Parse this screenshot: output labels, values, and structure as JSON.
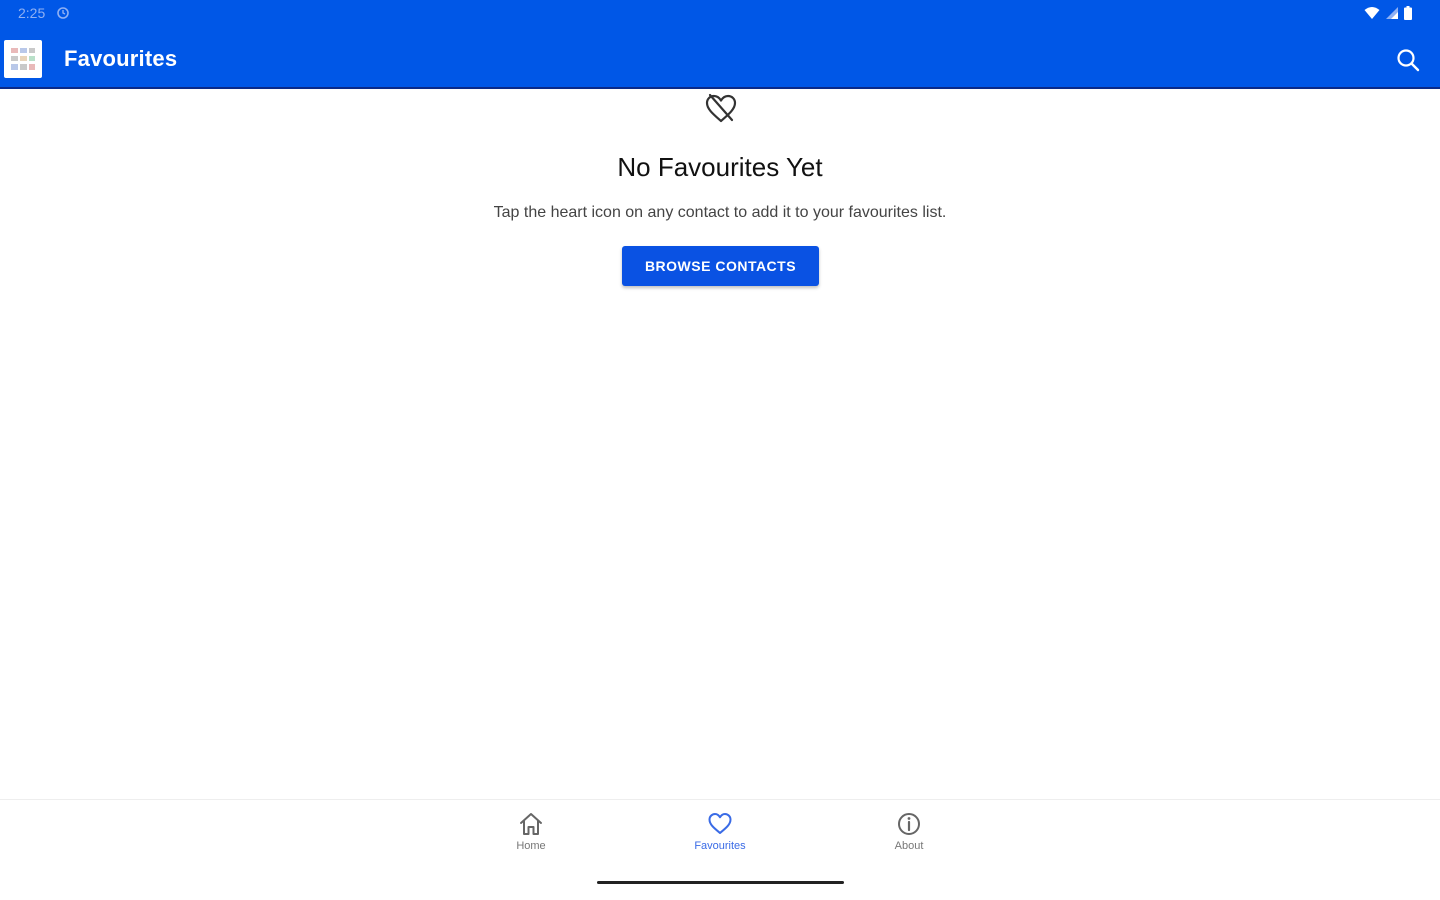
{
  "status_bar": {
    "time": "2:25",
    "icons": [
      "sync-icon",
      "wifi-icon",
      "signal-icon",
      "battery-icon"
    ]
  },
  "app_bar": {
    "title": "Favourites",
    "logo_icon": "app-logo-icon",
    "search_icon": "search-icon",
    "background_color": "#0057e7"
  },
  "empty_state": {
    "icon": "heart-off-icon",
    "title": "No Favourites Yet",
    "description": "Tap the heart icon on any contact to add it to your favourites list.",
    "button_label": "BROWSE CONTACTS",
    "button_color": "#0a52e3"
  },
  "bottom_nav": {
    "items": [
      {
        "label": "Home",
        "icon": "home-icon",
        "active": false
      },
      {
        "label": "Favourites",
        "icon": "heart-icon",
        "active": true
      },
      {
        "label": "About",
        "icon": "info-icon",
        "active": false
      }
    ],
    "active_color": "#3a6be6"
  }
}
